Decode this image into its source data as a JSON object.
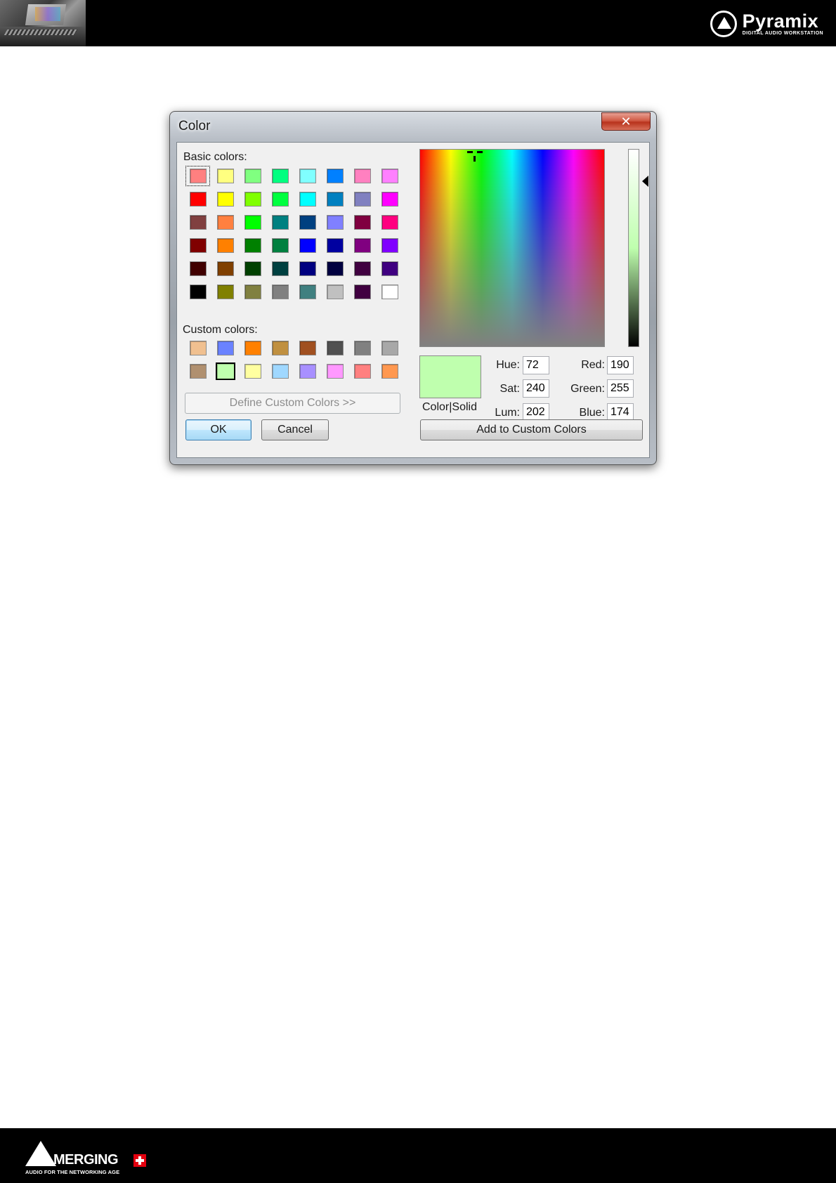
{
  "header": {
    "brand_name": "Pyramix",
    "brand_tagline": "DIGITAL AUDIO WORKSTATION"
  },
  "footer": {
    "brand_name": "MERGING",
    "brand_tagline": "AUDIO FOR THE NETWORKING AGE"
  },
  "dialog": {
    "title": "Color",
    "close_label": "✕",
    "basic_label": "Basic colors:",
    "custom_label": "Custom colors:",
    "basic_colors": [
      "#ff8080",
      "#ffff80",
      "#80ff80",
      "#00ff80",
      "#80ffff",
      "#0080ff",
      "#ff80c0",
      "#ff80ff",
      "#ff0000",
      "#ffff00",
      "#80ff00",
      "#00ff40",
      "#00ffff",
      "#0080c0",
      "#8080c0",
      "#ff00ff",
      "#804040",
      "#ff8040",
      "#00ff00",
      "#008080",
      "#004080",
      "#8080ff",
      "#800040",
      "#ff0080",
      "#800000",
      "#ff8000",
      "#008000",
      "#008040",
      "#0000ff",
      "#0000a0",
      "#800080",
      "#8000ff",
      "#400000",
      "#804000",
      "#004000",
      "#004040",
      "#000080",
      "#000040",
      "#400040",
      "#400080",
      "#000000",
      "#808000",
      "#808040",
      "#808080",
      "#408080",
      "#c0c0c0",
      "#400040",
      "#ffffff"
    ],
    "basic_focused_index": 0,
    "custom_colors": [
      "#f0c090",
      "#6a82ff",
      "#ff8000",
      "#c09040",
      "#a05020",
      "#505050",
      "#808080",
      "#a8a8a8",
      "#b09070",
      "#bfffae",
      "#ffffa0",
      "#a0d8ff",
      "#a890ff",
      "#ff98ff",
      "#ff8080",
      "#ff9850"
    ],
    "custom_selected_index": 9,
    "define_custom_label": "Define Custom Colors >>",
    "ok_label": "OK",
    "cancel_label": "Cancel",
    "add_custom_label": "Add to Custom Colors",
    "color_solid_label": "Color|Solid",
    "preview_color": "#bfffae",
    "hue_label": "Hue:",
    "hue": "72",
    "sat_label": "Sat:",
    "sat": "240",
    "lum_label": "Lum:",
    "lum": "202",
    "red_label": "Red:",
    "red": "190",
    "green_label": "Green:",
    "green": "255",
    "blue_label": "Blue:",
    "blue": "174"
  }
}
